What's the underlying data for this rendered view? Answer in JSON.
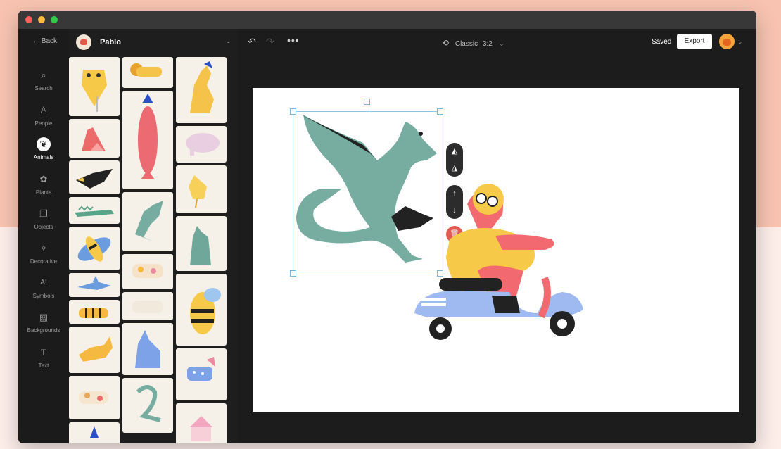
{
  "nav": {
    "back": "Back",
    "items": [
      {
        "label": "Search",
        "icon": "search-icon",
        "glyph": "⌕"
      },
      {
        "label": "People",
        "icon": "person-icon",
        "glyph": "♙"
      },
      {
        "label": "Animals",
        "icon": "paw-icon",
        "glyph": "❦"
      },
      {
        "label": "Plants",
        "icon": "plant-icon",
        "glyph": "✿"
      },
      {
        "label": "Objects",
        "icon": "objects-icon",
        "glyph": "❐"
      },
      {
        "label": "Decorative",
        "icon": "sparkle-icon",
        "glyph": "✧"
      },
      {
        "label": "Symbols",
        "icon": "symbols-icon",
        "glyph": "A!"
      },
      {
        "label": "Backgrounds",
        "icon": "image-icon",
        "glyph": "▨"
      },
      {
        "label": "Text",
        "icon": "text-icon",
        "glyph": "T"
      }
    ],
    "active": "Animals"
  },
  "panel": {
    "title": "Pablo"
  },
  "toolbar": {
    "undo": "↶",
    "redo": "↷",
    "more": "•••",
    "mode_icon": "⟲",
    "mode": "Classic",
    "ratio": "3:2",
    "chevron": "⌄",
    "saved": "Saved",
    "export": "Export"
  },
  "controls": {
    "flip_h": "◭",
    "flip_v": "◮",
    "up": "↑",
    "down": "↓",
    "delete": "🗑"
  },
  "colors": {
    "accent_selection": "#8fc3df",
    "dragon": "#76ada0",
    "delete": "#e25a52"
  }
}
